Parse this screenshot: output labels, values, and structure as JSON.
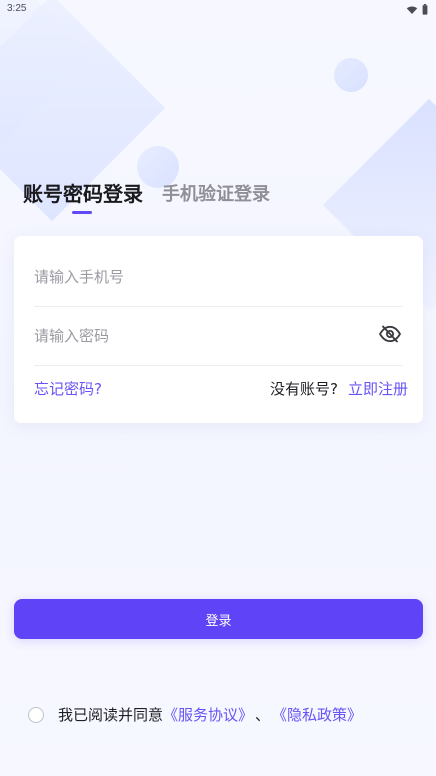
{
  "status_bar": {
    "time": "3:25",
    "icons": [
      "wifi-icon",
      "battery-icon"
    ]
  },
  "tabs": {
    "items": [
      {
        "label": "账号密码登录",
        "active": true
      },
      {
        "label": "手机验证登录",
        "active": false
      }
    ]
  },
  "form": {
    "phone_placeholder": "请输入手机号",
    "password_placeholder": "请输入密码",
    "password_toggle_icon": "eye-off-icon"
  },
  "links": {
    "forgot_password": "忘记密码?",
    "no_account": "没有账号?",
    "register": "立即注册"
  },
  "login_button": {
    "label": "登录"
  },
  "agreement": {
    "prefix": "我已阅读并同意",
    "service_link": "《服务协议》",
    "separator": "、",
    "privacy_link": "《隐私政策》"
  },
  "theme": {
    "accent": "#5f43f6",
    "link": "#6753f6",
    "background": "#f3f5ff"
  }
}
